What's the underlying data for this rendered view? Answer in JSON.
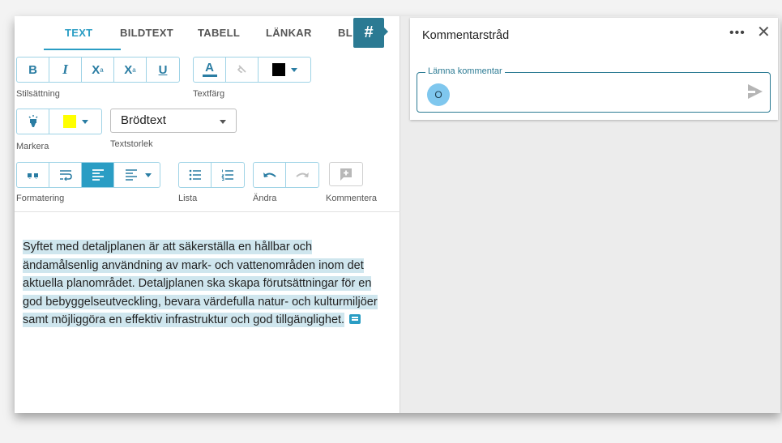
{
  "tabs": [
    {
      "label": "TEXT",
      "active": true
    },
    {
      "label": "BILDTEXT",
      "active": false
    },
    {
      "label": "TABELL",
      "active": false
    },
    {
      "label": "LÄNKAR",
      "active": false
    },
    {
      "label": "BL",
      "active": false
    }
  ],
  "hash_button": "#",
  "toolbar": {
    "bold": "B",
    "italic": "I",
    "superscript": "X",
    "superscript_mark": "a",
    "subscript": "X",
    "subscript_mark": "a",
    "underline": "U",
    "text_color_letter": "A",
    "text_color_value": "#000000",
    "highlight_color_value": "#ffff00",
    "group_labels": {
      "stilsattning": "Stilsättning",
      "textfarg": "Textfärg",
      "markera": "Markera",
      "textstorlek": "Textstorlek",
      "formatering": "Formatering",
      "lista": "Lista",
      "andra": "Ändra",
      "kommentera": "Kommentera"
    },
    "textsize_select": "Brödtext"
  },
  "document": {
    "paragraph": "Syftet med detaljplanen är att säkerställa en hållbar och ändamålsenlig användning av mark- och vattenområden inom det aktuella planområdet. Detaljplanen ska skapa förutsättningar för en god bebyggelseutveckling, bevara värdefulla natur- och kulturmiljöer samt möjliggöra en effektiv infrastruktur och god tillgänglighet."
  },
  "comment_panel": {
    "title": "Kommentarstråd",
    "input_label": "Lämna kommentar",
    "avatar_initial": "O",
    "accent_color": "#2b7a93"
  }
}
